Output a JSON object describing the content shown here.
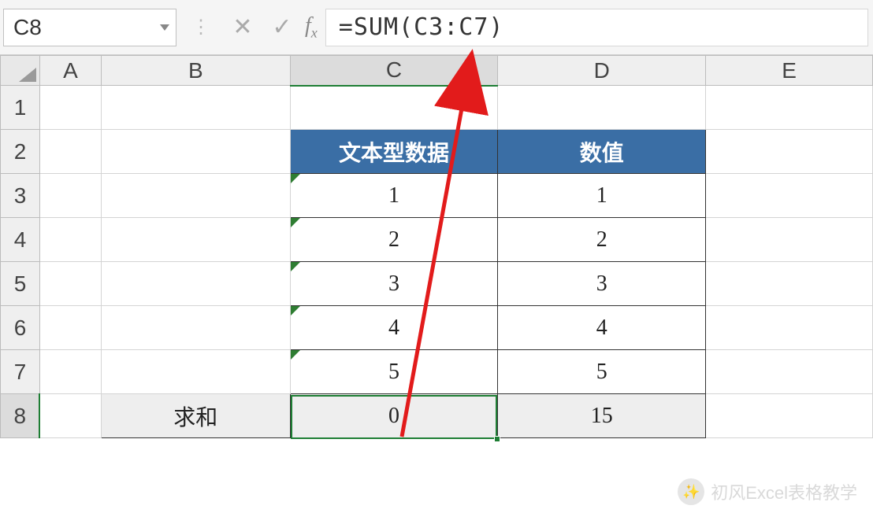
{
  "formula_bar": {
    "name_box": "C8",
    "formula": "=SUM(C3:C7)"
  },
  "columns": [
    "A",
    "B",
    "C",
    "D",
    "E"
  ],
  "rows": [
    "1",
    "2",
    "3",
    "4",
    "5",
    "6",
    "7",
    "8"
  ],
  "selected_column": "C",
  "selected_row": "8",
  "headers": {
    "c2": "文本型数据",
    "d2": "数值"
  },
  "data_rows": [
    {
      "c": "1",
      "d": "1"
    },
    {
      "c": "2",
      "d": "2"
    },
    {
      "c": "3",
      "d": "3"
    },
    {
      "c": "4",
      "d": "4"
    },
    {
      "c": "5",
      "d": "5"
    }
  ],
  "sum_row": {
    "label": "求和",
    "c_value": "0",
    "d_value": "15"
  },
  "watermark": "初风Excel表格教学"
}
